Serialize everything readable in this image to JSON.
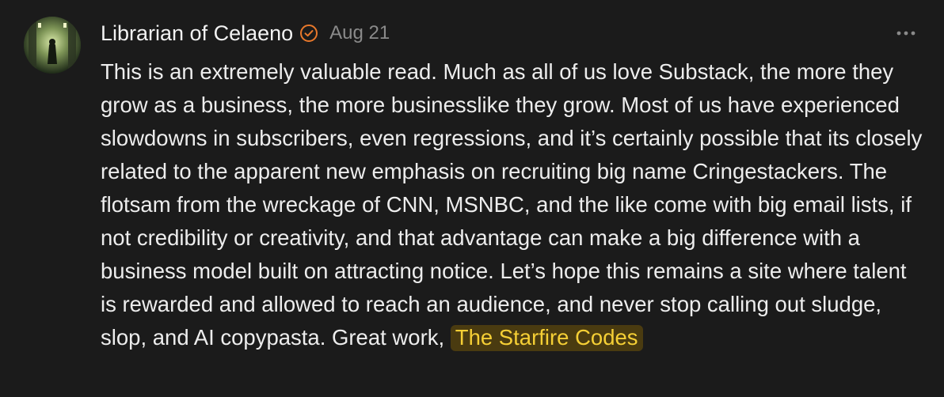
{
  "comment": {
    "author": "Librarian of Celaeno",
    "date": "Aug 21",
    "badge_icon": "verified-check-icon",
    "accent_color": "#e8782b",
    "more_icon": "more-horizontal-icon",
    "body": "This is an extremely valuable read. Much as all of us love Substack, the more they grow as a business, the more businesslike they grow. Most of us have experienced slowdowns in subscribers, even regressions, and it’s certainly possible that its closely related to the apparent new emphasis on recruiting big name Cringestackers. The flotsam from the wreckage of CNN, MSNBC, and the like come with big email lists, if not credibility or creativity, and that advantage can make a big difference with a business model built on attracting notice. Let’s hope this remains a site where talent is rewarded and allowed to reach an audience, and never stop calling out sludge, slop, and AI copypasta. Great work,",
    "mention": "The Starfire Codes",
    "mention_color": "#f5cf35"
  }
}
